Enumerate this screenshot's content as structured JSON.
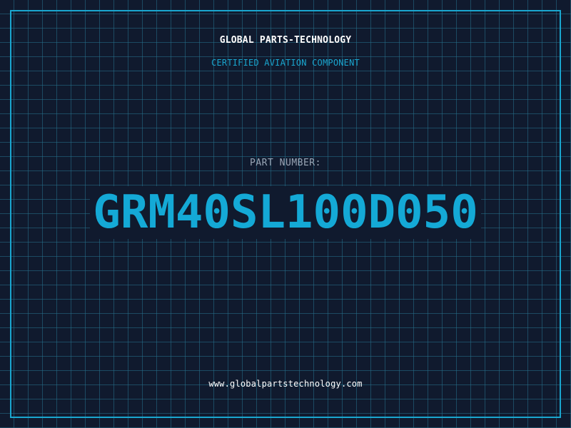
{
  "header": {
    "company": "GLOBAL PARTS-TECHNOLOGY",
    "tagline": "CERTIFIED AVIATION COMPONENT"
  },
  "part": {
    "label": "PART NUMBER:",
    "number": "GRM40SL100D050"
  },
  "footer": {
    "website": "www.globalpartstechnology.com"
  },
  "colors": {
    "background": "#101a2e",
    "grid": "#26708c",
    "accent": "#1aa6cf",
    "label": "#9aa6b6",
    "text": "#ffffff"
  }
}
